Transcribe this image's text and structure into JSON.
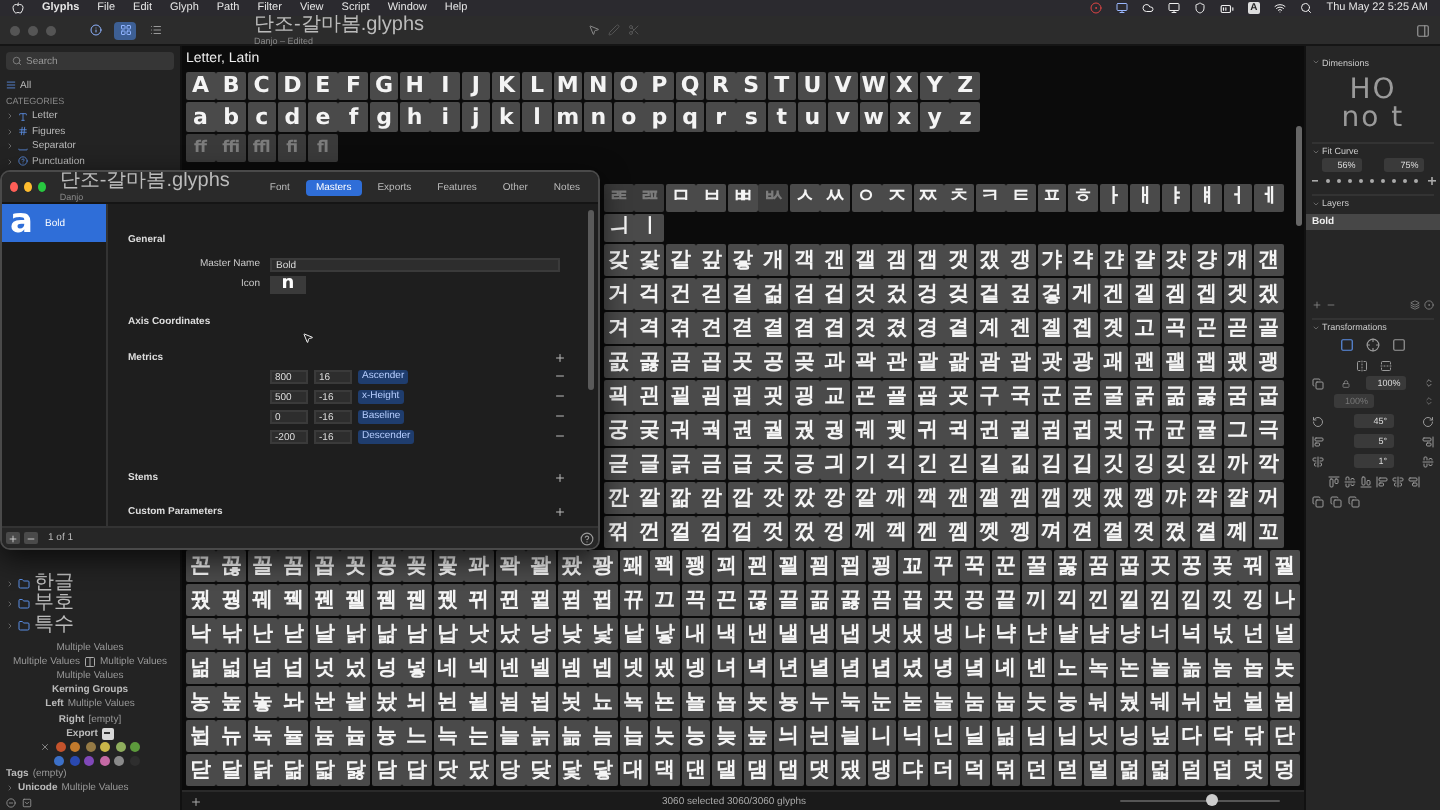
{
  "menu_bar": {
    "app": "Glyphs",
    "items": [
      "File",
      "Edit",
      "Glyph",
      "Path",
      "Filter",
      "View",
      "Script",
      "Window",
      "Help"
    ],
    "input_source": "A",
    "clock": "Thu May 22 5:25 AM"
  },
  "window": {
    "title": "단조-갈마봄.glyphs",
    "subtitle": "Danjo – Edited"
  },
  "sidebar": {
    "search": {
      "placeholder": "Search"
    },
    "all": "All",
    "categories_heading": "CATEGORIES",
    "categories": [
      {
        "label": "Letter",
        "kind": "letter",
        "expanded": false
      },
      {
        "label": "Figures",
        "kind": "figures",
        "expanded": false
      },
      {
        "label": "Separator",
        "kind": "separator",
        "expanded": false
      },
      {
        "label": "Punctuation",
        "kind": "punctuation",
        "expanded": false
      }
    ],
    "folders": [
      {
        "label": "한글",
        "expanded": false
      },
      {
        "label": "부호",
        "expanded": false
      },
      {
        "label": "특수",
        "expanded": false
      }
    ]
  },
  "glyph_info": {
    "name": "Multiple Values",
    "left_sidebearing": "Multiple Values",
    "right_sidebearing": "Multiple Values",
    "width": "Multiple Values",
    "kerning_heading": "Kerning Groups",
    "kerning": [
      {
        "label": "Left",
        "value": "Multiple Values"
      },
      {
        "label": "Right",
        "value": "[empty]"
      }
    ],
    "export": {
      "label": "Export",
      "mixed": true
    },
    "label_colors": [
      {
        "color": "#c4532c"
      },
      {
        "color": "#c27a2c"
      },
      {
        "color": "#957a45"
      },
      {
        "color": "#c9b649"
      },
      {
        "color": "#8fae5d"
      },
      {
        "color": "#5c9a3c"
      },
      {
        "color": "#3c70c8"
      },
      {
        "color": "#2a49b0"
      },
      {
        "color": "#8048b8"
      },
      {
        "color": "#c56aa5"
      },
      {
        "color": "#8a8a8a"
      },
      {
        "color": "#2e2e2e"
      }
    ],
    "tags": {
      "label": "Tags",
      "value": "(empty)"
    },
    "unicode": {
      "label": "Unicode",
      "value": "Multiple Values",
      "expanded": false
    }
  },
  "latin_section": {
    "title": "Letter, Latin",
    "rows": [
      {
        "glyphs": "A B C D E F G H I J K L M N O P Q R S T U V W X Y Z",
        "dim": false
      },
      {
        "glyphs": "a b c d e f g h i j k l m n o p q r s t u v w x y z",
        "dim": false
      },
      {
        "glyphs": "ff ffi ffl fi fl",
        "dim": true
      }
    ]
  },
  "hangul_jamo": [
    [
      {
        "glyph": "ㄾ",
        "dim": true
      },
      {
        "glyph": "ㄿ",
        "dim": true
      },
      {
        "glyph": "ㅁ",
        "dim": false
      },
      {
        "glyph": "ㅂ",
        "dim": false
      },
      {
        "glyph": "ㅃ",
        "dim": false
      },
      {
        "glyph": "ㅄ",
        "dim": true
      },
      {
        "glyph": "ㅅ",
        "dim": false
      },
      {
        "glyph": "ㅆ",
        "dim": false
      },
      {
        "glyph": "ㅇ",
        "dim": false
      },
      {
        "glyph": "ㅈ",
        "dim": false
      },
      {
        "glyph": "ㅉ",
        "dim": false
      },
      {
        "glyph": "ㅊ",
        "dim": false
      },
      {
        "glyph": "ㅋ",
        "dim": false
      },
      {
        "glyph": "ㅌ",
        "dim": false
      },
      {
        "glyph": "ㅍ",
        "dim": false
      },
      {
        "glyph": "ㅎ",
        "dim": false
      },
      {
        "glyph": "ㅏ",
        "dim": false
      },
      {
        "glyph": "ㅐ",
        "dim": false
      },
      {
        "glyph": "ㅑ",
        "dim": false
      },
      {
        "glyph": "ㅒ",
        "dim": false
      },
      {
        "glyph": "ㅓ",
        "dim": false
      },
      {
        "glyph": "ㅔ",
        "dim": false
      }
    ],
    [
      {
        "glyph": "ㅢ",
        "dim": false
      },
      {
        "glyph": "ㅣ",
        "dim": false
      }
    ]
  ],
  "hangul_rows_partial": [
    "갖 갗 같 갚 갛 개 객 갠 갤 갬 갭 갯 갰 갱 갸 갹 갼 걀 걋 걍 걔 걘",
    "거 걱 건 걷 걸 걺 검 겁 것 겄 겅 겆 겉 겊 겋 게 겐 겔 겜 겝 겟 겠",
    "겨 격 겪 견 겯 결 겸 겹 겻 겼 경 곁 계 곈 곌 곕 곗 고 곡 곤 곧 골",
    "곬 곯 곰 곱 곳 공 곶 과 곽 관 괄 괆 괌 괍 괏 광 괘 괜 괠 괩 괬 괭",
    "괵 괸 괼 굄 굅 굇 굉 교 굔 굘 굡 굣 구 국 군 굳 굴 굵 굶 굻 굼 굽",
    "궁 궂 궈 궉 권 궐 궜 궝 궤 궷 귀 귁 귄 귈 귐 귑 귓 규 균 귤 그 극",
    "귿 글 긁 금 급 긋 긍 긔 기 긱 긴 긷 길 긺 김 깁 깃 깅 깆 깊 까 깍",
    "깐 깔 깖 깜 깝 깟 깠 깡 깥 깨 깩 깬 깰 깸 깹 깻 깼 깽 꺄 꺅 꺌 꺼",
    "꺾 껀 껄 껌 껍 껏 껐 껑 께 껙 껜 껨 껫 껭 껴 껸 껼 꼇 꼈 꼍 꼐 꼬"
  ],
  "hangul_rows": [
    "꼰 꼲 꼴 꼼 꼽 꼿 꽁 꽂 꽃 꽈 꽉 꽐 꽜 꽝 꽤 꽥 꽹 꾀 꾄 꾈 꾐 꾑 꾕 꾜 꾸 꾹 꾼 꿀 꿇 꿈 꿉 꿋 꿍 꿎 꿔 꿜",
    "꿨 꿩 꿰 꿱 꿴 꿸 뀀 뀁 뀄 뀌 뀐 뀔 뀜 뀝 뀨 끄 끅 끈 끊 끌 끎 끓 끔 끕 끗 끙 끝 끼 끽 낀 낄 낌 낍 낏 낑 나",
    "낙 낚 난 낟 날 낡 낢 남 납 낫 났 낭 낮 낯 낱 낳 내 낵 낸 낼 냄 냅 냇 냈 냉 냐 냑 냔 냘 냠 냥 너 넉 넋 넌 널",
    "넒 넓 넘 넙 넛 넜 넝 넣 네 넥 넨 넬 넴 넵 넷 넸 넹 녀 녁 년 녈 념 녑 녔 녕 녘 녜 녠 노 녹 논 놀 놂 놈 놉 놋",
    "농 높 놓 놔 놘 놜 놨 뇌 뇐 뇔 뇜 뇝 뇟 뇨 뇩 뇬 뇰 뇹 뇻 뇽 누 눅 눈 눋 눌 눔 눕 눗 눙 눠 눴 눼 뉘 뉜 뉠 뉨",
    "뉩 뉴 뉵 뉼 늄 늅 늉 느 늑 는 늘 늙 늚 늠 늡 늣 능 늦 늪 늬 늰 늴 니 닉 닌 닐 닒 님 닙 닛 닝 닢 다 닥 닦 단",
    "닫 달 닭 닮 닯 닳 담 답 닷 닸 당 닺 닻 닿 대 댁 댄 댈 댐 댑 댓 댔 댕 댜 더 덕 덖 던 덛 덜 덞 덟 덤 덥 덧 덩"
  ],
  "status_bar": {
    "text": "3060 selected 3060/3060 glyphs",
    "zoom_slider": {
      "level": 0.58
    }
  },
  "inspector": {
    "dimensions": {
      "title": "Dimensions",
      "preview_lines": [
        "HO",
        "no t"
      ]
    },
    "fit_curve": {
      "title": "Fit Curve",
      "values": [
        "56%",
        "75%"
      ]
    },
    "layers": {
      "title": "Layers",
      "items": [
        {
          "name": "Bold",
          "selected": true
        }
      ]
    },
    "transformations": {
      "title": "Transformations",
      "scale": "100%",
      "scale_vertical": "100%",
      "rotate": "45°",
      "slant": "5°",
      "skew": "1°"
    }
  },
  "font_info_dialog": {
    "title": "단조-갈마봄.glyphs",
    "subtitle": "Danjo",
    "tabs": [
      {
        "label": "Font",
        "selected": false
      },
      {
        "label": "Masters",
        "selected": true
      },
      {
        "label": "Exports",
        "selected": false
      },
      {
        "label": "Features",
        "selected": false
      },
      {
        "label": "Other",
        "selected": false
      },
      {
        "label": "Notes",
        "selected": false
      }
    ],
    "masters": [
      {
        "icon_glyph": "a",
        "name": "Bold",
        "selected": true
      }
    ],
    "general": {
      "heading": "General",
      "master_name_label": "Master Name",
      "master_name": "Bold",
      "icon_label": "Icon",
      "icon_glyph": "n"
    },
    "axis_heading": "Axis Coordinates",
    "metrics": {
      "heading": "Metrics",
      "rows": [
        {
          "value": "800",
          "overshoot": "16",
          "name": "Ascender"
        },
        {
          "value": "500",
          "overshoot": "-16",
          "name": "x-Height"
        },
        {
          "value": "0",
          "overshoot": "-16",
          "name": "Baseline"
        },
        {
          "value": "-200",
          "overshoot": "-16",
          "name": "Descender"
        }
      ]
    },
    "stems_heading": "Stems",
    "custom_parameters_heading": "Custom Parameters",
    "footer": {
      "count": "1 of 1"
    }
  }
}
